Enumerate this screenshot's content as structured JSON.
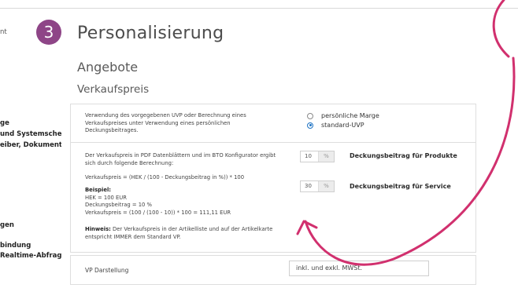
{
  "step": {
    "number": "3"
  },
  "left_fragments": [
    {
      "text": "nt",
      "light": true
    },
    {
      "text": "ge"
    },
    {
      "text": "und Systemschein"
    },
    {
      "text": "eiber, Dokumente"
    },
    {
      "text": "gen"
    },
    {
      "text": "bindung"
    },
    {
      "text": "Realtime-Abfrage)"
    }
  ],
  "header": {
    "title": "Personalisierung",
    "subtitle": "Angebote",
    "section": "Verkaufspreis"
  },
  "uvp_block": {
    "description_lines": [
      "Verwendung des vorgegebenen UVP oder Berechnung eines",
      "Verkaufspreises unter Verwendung eines persönlichen",
      "Deckungsbeitrages."
    ],
    "options": [
      {
        "label": "persönliche Marge",
        "checked": false
      },
      {
        "label": "standard-UVP",
        "checked": true
      }
    ]
  },
  "calc_block": {
    "intro_lines": [
      "Der Verkaufspreis in PDF Datenblättern und im BTO Konfigurator ergibt",
      "sich durch folgende Berechnung:"
    ],
    "formula": "Verkaufspreis = (HEK / (100 - Deckungsbeitrag in %)) * 100",
    "example_title": "Beispiel:",
    "example_lines": [
      "HEK = 100 EUR",
      "Deckungsbeitrag = 10 %",
      "Verkaufspreis = (100 / (100 - 10)) * 100 = 111,11 EUR"
    ],
    "hint_title": "Hinweis:",
    "hint_lines": [
      " Der Verkaufspreis in der Artikelliste und auf der Artikelkarte",
      "entspricht IMMER dem Standard VP."
    ],
    "inputs": [
      {
        "value": "10",
        "unit": "%",
        "label": "Deckungsbeitrag für Produkte"
      },
      {
        "value": "30",
        "unit": "%",
        "label": "Deckungsbeitrag für Service"
      }
    ]
  },
  "vp_block": {
    "label": "VP Darstellung",
    "selected": "inkl. und exkl. MWSt."
  },
  "colors": {
    "accent": "#8e4587",
    "annotation": "#d1306e",
    "radio_active": "#1f74c4"
  }
}
